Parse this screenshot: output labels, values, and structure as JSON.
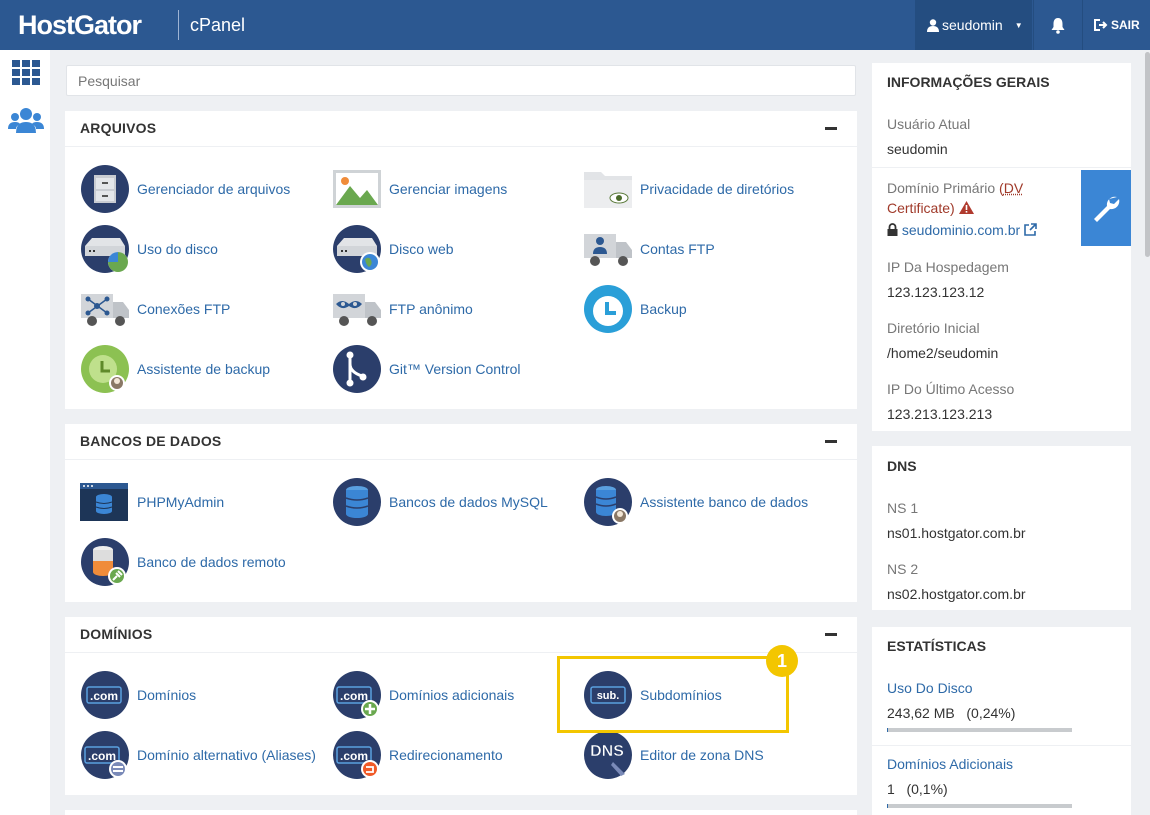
{
  "header": {
    "brand": "HostGator",
    "product": "cPanel",
    "username": "seudomin",
    "logout_label": "SAIR"
  },
  "search": {
    "placeholder": "Pesquisar"
  },
  "sections": {
    "arquivos": {
      "title": "ARQUIVOS",
      "items": [
        "Gerenciador de arquivos",
        "Gerenciar imagens",
        "Privacidade de diretórios",
        "Uso do disco",
        "Disco web",
        "Contas FTP",
        "Conexões FTP",
        "FTP anônimo",
        "Backup",
        "Assistente de backup",
        "Git™ Version Control"
      ]
    },
    "bancos": {
      "title": "BANCOS DE DADOS",
      "items": [
        "PHPMyAdmin",
        "Bancos de dados MySQL",
        "Assistente banco de dados",
        "Banco de dados remoto"
      ]
    },
    "dominios": {
      "title": "DOMÍNIOS",
      "items": [
        "Domínios",
        "Domínios adicionais",
        "Subdomínios",
        "Domínio alternativo (Aliases)",
        "Redirecionamento",
        "Editor de zona DNS"
      ],
      "icon_text": {
        "com": ".com",
        "sub": "sub.",
        "dns": "DNS"
      }
    }
  },
  "highlight_badge": "1",
  "info": {
    "title": "INFORMAÇÕES GERAIS",
    "current_user_label": "Usuário Atual",
    "current_user": "seudomin",
    "primary_domain_label": "Domínio Primário",
    "primary_domain_cert_open": "(",
    "primary_domain_cert_dv": "DV",
    "primary_domain_cert_rest": "Certificate)",
    "primary_domain": "seudominio.com.br",
    "hosting_ip_label": "IP Da Hospedagem",
    "hosting_ip": "123.123.123.12",
    "home_dir_label": "Diretório Inicial",
    "home_dir": "/home2/seudomin",
    "last_ip_label": "IP Do Último Acesso",
    "last_ip": "123.213.123.213"
  },
  "dns": {
    "title": "DNS",
    "ns1_label": "NS 1",
    "ns1": "ns01.hostgator.com.br",
    "ns2_label": "NS 2",
    "ns2": "ns02.hostgator.com.br"
  },
  "stats": {
    "title": "ESTATÍSTICAS",
    "disk_label": "Uso Do Disco",
    "disk_value": "243,62 MB",
    "disk_pct": "(0,24%)",
    "disk_fraction": 0.0024,
    "addon_label": "Domínios Adicionais",
    "addon_value": "1",
    "addon_pct": "(0,1%)",
    "addon_fraction": 0.001
  },
  "colors": {
    "topbar": "#2c5891",
    "link": "#2e6aa8",
    "highlight": "#f3c600",
    "wrench": "#3b86d5"
  }
}
